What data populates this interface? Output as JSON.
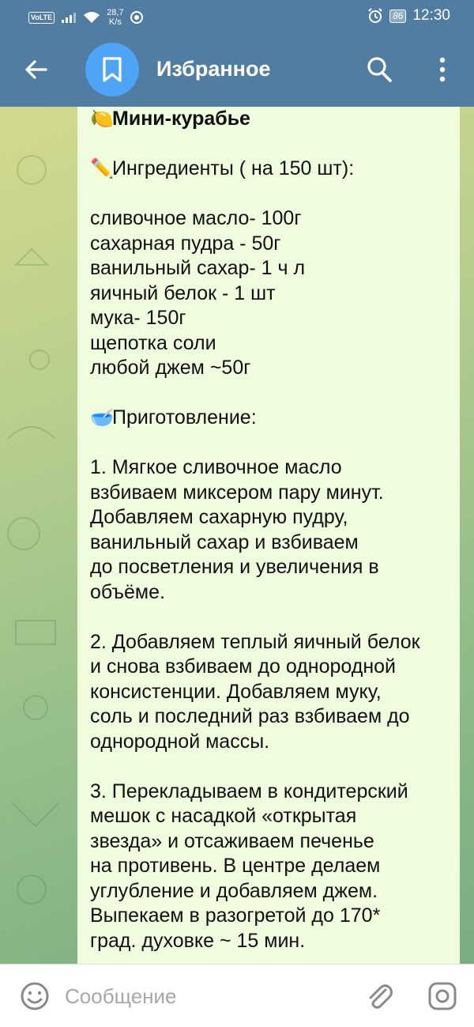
{
  "status_bar": {
    "volte": "VoLTE",
    "speed_value": "28,7",
    "speed_unit": "K/s",
    "battery": "86",
    "time": "12:30"
  },
  "header": {
    "title": "Избранное",
    "icons": {
      "back": "arrow-left",
      "avatar": "bookmark",
      "search": "magnifier",
      "menu": "kebab"
    },
    "colors": {
      "bar": "#517da2",
      "avatar": "#4ea4f6"
    }
  },
  "message": {
    "lines": [
      {
        "emoji": "🍋",
        "text": "Мини-курабье",
        "bold": true
      },
      {
        "text": ""
      },
      {
        "emoji": "✏️",
        "text": "Ингредиенты ( на 150 шт):"
      },
      {
        "text": ""
      },
      {
        "text": "сливочное масло- 100г"
      },
      {
        "text": "сахарная пудра - 50г"
      },
      {
        "text": "ванильный сахар- 1 ч л"
      },
      {
        "text": "яичный белок - 1 шт"
      },
      {
        "text": "мука- 150г"
      },
      {
        "text": "щепотка соли"
      },
      {
        "text": "любой джем ~50г"
      },
      {
        "text": ""
      },
      {
        "emoji": "🥣",
        "text": "Приготовление:"
      },
      {
        "text": ""
      },
      {
        "text": "1. Мягкое сливочное масло"
      },
      {
        "text": "взбиваем миксером пару минут."
      },
      {
        "text": "Добавляем сахарную пудру,"
      },
      {
        "text": "ванильный сахар и взбиваем"
      },
      {
        "text": "до посветления и увеличения в"
      },
      {
        "text": "объёме."
      },
      {
        "text": ""
      },
      {
        "text": "2. Добавляем теплый яичный белок"
      },
      {
        "text": "и снова взбиваем до однородной"
      },
      {
        "text": "консистенции. Добавляем муку,"
      },
      {
        "text": "соль и последний раз взбиваем до"
      },
      {
        "text": "однородной массы."
      },
      {
        "text": ""
      },
      {
        "text": "3. Перекладываем в кондитерский"
      },
      {
        "text": "мешок с насадкой «открытая"
      },
      {
        "text": "звезда» и отсаживаем печенье"
      },
      {
        "text": "на противень. В центре делаем"
      },
      {
        "text": "углубление и добавляем джем."
      },
      {
        "text": "Выпекаем в разогретой до 170*"
      },
      {
        "text": "град. духовке ~ 15 мин."
      }
    ]
  },
  "input_bar": {
    "placeholder": "Сообщение",
    "icons": {
      "emoji": "smiley",
      "attach": "paperclip",
      "camera": "instagram-camera"
    }
  }
}
